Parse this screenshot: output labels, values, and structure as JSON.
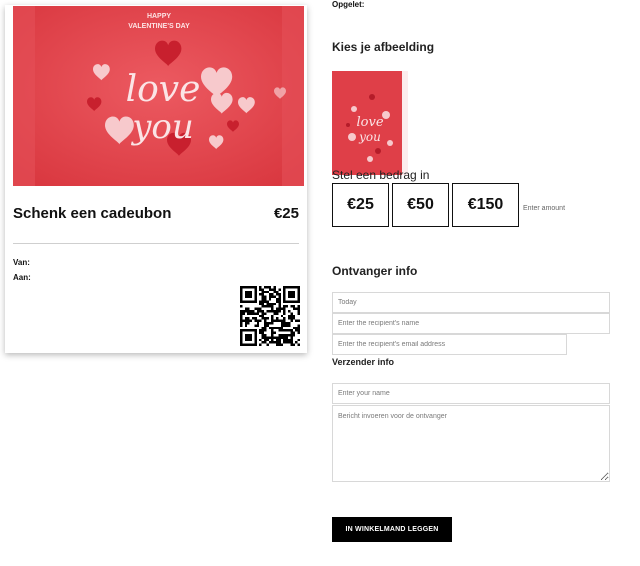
{
  "card": {
    "image": {
      "line1": "HAPPY",
      "line2": "VALENTINE'S DAY",
      "script1": "love",
      "script2": "you"
    },
    "title": "Schenk een cadeubon",
    "price": "€25",
    "from_label": "Van:",
    "to_label": "Aan:"
  },
  "form": {
    "top_label": "Opgelet:",
    "choose_image_heading": "Kies je afbeelding",
    "amount_heading": "Stel een bedrag in",
    "amounts": [
      "€25",
      "€50",
      "€150"
    ],
    "enter_amount_placeholder": "Enter amount",
    "recipient_heading": "Ontvanger info",
    "date_placeholder": "Today",
    "recipient_name_placeholder": "Enter the recipient's name",
    "recipient_email_placeholder": "Enter the recipient's email address",
    "sender_heading": "Verzender info",
    "sender_name_placeholder": "Enter your name",
    "message_placeholder": "Bericht invoeren voor de ontvanger",
    "add_to_cart_label": "IN WINKELMAND LEGGEN"
  },
  "colors": {
    "card_background_red": "#e2474f",
    "heart_red": "#d72a36",
    "heart_pink": "#f6c4c7",
    "button_black": "#000000"
  }
}
